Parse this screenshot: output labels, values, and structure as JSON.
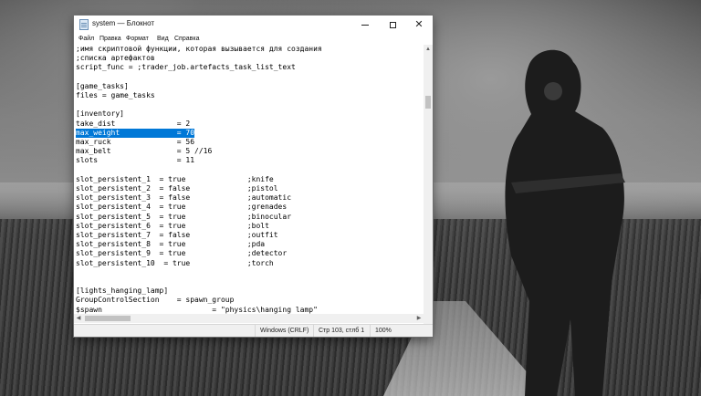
{
  "window": {
    "title": "system — Блокнот"
  },
  "menu": [
    "Файл",
    "Правка",
    "Формат",
    "Вид",
    "Справка"
  ],
  "editor": {
    "lines": [
      ";имя скриптовой функции, которая вызывается для создания",
      ";списка артефактов",
      "script_func = ;trader_job.artefacts_task_list_text",
      "",
      "[game_tasks]",
      "files = game_tasks",
      "",
      "[inventory]",
      "take_dist              = 2",
      "max_weight             = 70",
      "max_ruck               = 56",
      "max_belt               = 5 //16",
      "slots                  = 11",
      "",
      "slot_persistent_1  = true              ;knife",
      "slot_persistent_2  = false             ;pistol",
      "slot_persistent_3  = false             ;automatic",
      "slot_persistent_4  = true              ;grenades",
      "slot_persistent_5  = true              ;binocular",
      "slot_persistent_6  = true              ;bolt",
      "slot_persistent_7  = false             ;outfit",
      "slot_persistent_8  = true              ;pda",
      "slot_persistent_9  = true              ;detector",
      "slot_persistent_10  = true             ;torch",
      "",
      "",
      "[lights_hanging_lamp]",
      "GroupControlSection    = spawn_group",
      "$spawn                         = \"physics\\hanging lamp\""
    ],
    "selected_line_index": 9,
    "selected_text": "max_weight             = 70"
  },
  "status": {
    "encoding": "Windows (CRLF)",
    "position": "Стр 103, стлб 1",
    "zoom": "100%"
  },
  "icons": {
    "app": "notepad-icon",
    "minimize": "minimize-icon",
    "maximize": "maximize-icon",
    "close": "close-icon"
  },
  "colors": {
    "selection": "#0078d7"
  }
}
